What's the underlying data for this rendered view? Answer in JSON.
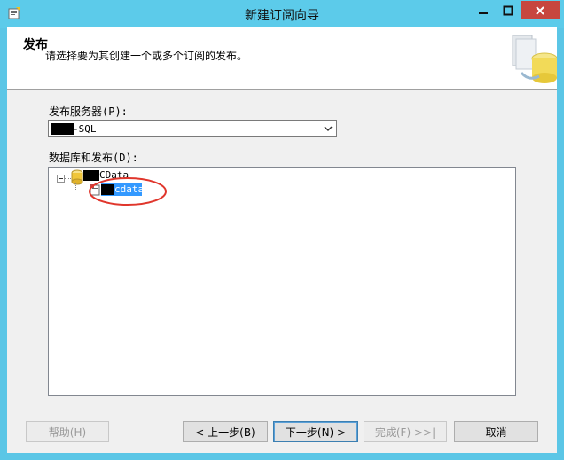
{
  "window": {
    "title": "新建订阅向导"
  },
  "header": {
    "title": "发布",
    "description": "请选择要为其创建一个或多个订阅的发布。"
  },
  "server": {
    "label": "发布服务器(P):",
    "value": "-SQL"
  },
  "tree": {
    "label": "数据库和发布(D):",
    "database_name": "CData",
    "publication_name": "cdata"
  },
  "buttons": {
    "help": "帮助(H)",
    "back": "< 上一步(B)",
    "next": "下一步(N) >",
    "finish": "完成(F) >>|",
    "cancel": "取消"
  },
  "colors": {
    "titlebar": "#5ccbea",
    "close_button": "#c7463f",
    "selection": "#3399ff",
    "annotation": "#e0362c"
  }
}
